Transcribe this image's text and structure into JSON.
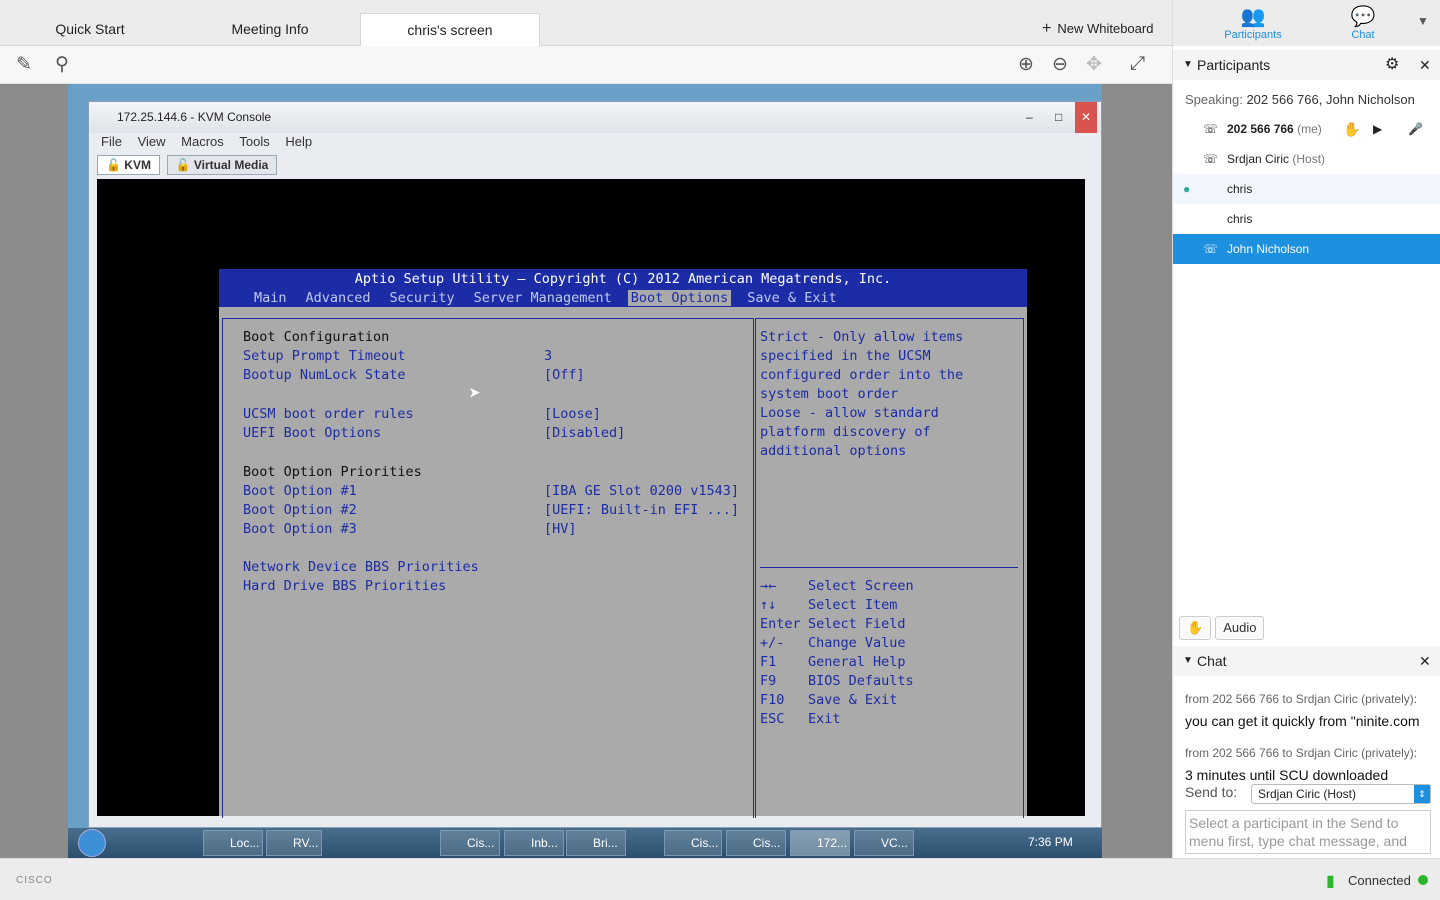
{
  "tabs": [
    "Quick Start",
    "Meeting Info",
    "chris's screen"
  ],
  "new_whiteboard": "New Whiteboard",
  "kvm": {
    "title": "172.25.144.6 - KVM Console",
    "menu": [
      "File",
      "View",
      "Macros",
      "Tools",
      "Help"
    ],
    "tabs": [
      "KVM",
      "Virtual Media"
    ]
  },
  "bios": {
    "title": "Aptio Setup Utility – Copyright (C) 2012 American Megatrends, Inc.",
    "menu": [
      "Main",
      "Advanced",
      "Security",
      "Server Management",
      "Boot Options",
      "Save & Exit"
    ],
    "section1": "Boot Configuration",
    "setup_prompt": "Setup Prompt Timeout",
    "setup_prompt_val": "3",
    "numlock": "Bootup NumLock State",
    "numlock_val": "[Off]",
    "ucsm": "UCSM boot order rules",
    "ucsm_val": "[Loose]",
    "uefi": "UEFI Boot Options",
    "uefi_val": "[Disabled]",
    "section2": "Boot Option Priorities",
    "opt1": "Boot Option #1",
    "opt1_val": "[IBA GE Slot 0200 v1543]",
    "opt2": "Boot Option #2",
    "opt2_val": "[UEFI: Built-in EFI ...]",
    "opt3": "Boot Option #3",
    "opt3_val": "[HV]",
    "net": "Network Device BBS Priorities",
    "hdd": "Hard Drive BBS Priorities",
    "help": [
      "Strict - Only allow items",
      "specified in the UCSM",
      "configured order into the",
      "system boot order",
      "Loose - allow standard",
      "platform discovery of",
      "additional options"
    ],
    "keys": [
      [
        "→←",
        "Select Screen"
      ],
      [
        "↑↓",
        "Select Item"
      ],
      [
        "Enter",
        "Select Field"
      ],
      [
        "+/-",
        "Change Value"
      ],
      [
        "F1",
        "General Help"
      ],
      [
        "F9",
        "BIOS Defaults"
      ],
      [
        "F10",
        "Save & Exit"
      ],
      [
        "ESC",
        "Exit"
      ]
    ]
  },
  "taskbar": {
    "items": [
      "Loc...",
      "RV...",
      "Cis...",
      "Inb...",
      "Bri...",
      "Cis...",
      "Cis...",
      "172...",
      "VC..."
    ],
    "clock": "7:36 PM"
  },
  "sidebar": {
    "participants_tab": "Participants",
    "chat_tab": "Chat",
    "participants_header": "Participants",
    "speaking_label": "Speaking:",
    "speaking_value": "202 566 766, John Nicholson",
    "people": [
      {
        "name": "202 566 766",
        "suffix": "(me)"
      },
      {
        "name": "Srdjan Ciric",
        "suffix": "(Host)"
      },
      {
        "name": "chris",
        "suffix": ""
      },
      {
        "name": "chris",
        "suffix": ""
      },
      {
        "name": "John Nicholson",
        "suffix": ""
      }
    ],
    "audio_button": "Audio",
    "chat_header": "Chat",
    "chat": [
      {
        "meta": "from 202 566 766 to Srdjan Ciric (privately):",
        "msg": "you can get it quickly from \"ninite.com"
      },
      {
        "meta": "from 202 566 766 to Srdjan Ciric (privately):",
        "msg": "3 minutes until SCU downloaded"
      }
    ],
    "send_to_label": "Send to:",
    "send_to_value": "Srdjan Ciric (Host)",
    "chat_placeholder": "Select a participant in the Send to menu first, type chat message, and"
  },
  "status": {
    "brand": "CISCO",
    "connected": "Connected"
  }
}
